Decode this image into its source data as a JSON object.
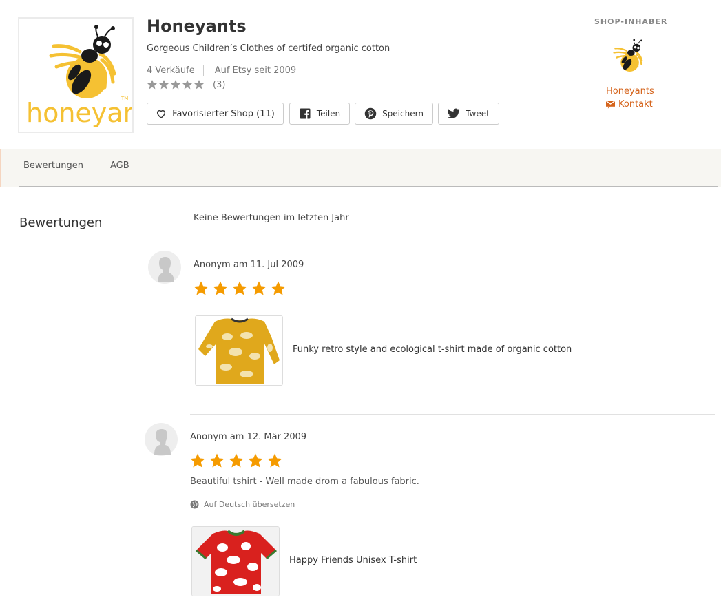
{
  "colors": {
    "accent": "#d5641c",
    "star_rating": "#f59b00",
    "star_muted": "#999999",
    "tabbar_bg": "#f7f6f2",
    "logo_yellow": "#f5c133"
  },
  "shop": {
    "logo_text": "honeyants",
    "name": "Honeyants",
    "tagline": "Gorgeous Children’s Clothes of certifed organic cotton",
    "sales": "4 Verkäufe",
    "since": "Auf Etsy seit 2009",
    "rating": 5,
    "rating_count": "(3)",
    "buttons": {
      "favorite": "Favorisierter Shop (11)",
      "share": "Teilen",
      "save": "Speichern",
      "tweet": "Tweet"
    },
    "icons": {
      "favorite": "heart-icon",
      "share": "facebook-icon",
      "save": "pinterest-icon",
      "tweet": "twitter-icon"
    }
  },
  "owner": {
    "title": "SHOP-INHABER",
    "name": "Honeyants",
    "contact": "Kontakt",
    "contact_icon": "envelope-icon"
  },
  "tabs": [
    {
      "label": "Bewertungen"
    },
    {
      "label": "AGB"
    }
  ],
  "reviews_section": {
    "title": "Bewertungen",
    "summary": "Keine Bewertungen im letzten Jahr",
    "reviews": [
      {
        "author_date": "Anonym am 11. Jul 2009",
        "stars": 5,
        "text": "",
        "item_title": "Funky retro style and ecological t-shirt made of organic cotton",
        "item_image": "yellow-longsleeve-shirt"
      },
      {
        "author_date": "Anonym am 12. Mär 2009",
        "stars": 5,
        "text": "Beautiful tshirt - Well made drom a fabulous fabric.",
        "translate_label": "Auf Deutsch übersetzen",
        "translate_icon": "globe-icon",
        "item_title": "Happy Friends Unisex T-shirt",
        "item_image": "red-white-tshirt"
      }
    ]
  }
}
